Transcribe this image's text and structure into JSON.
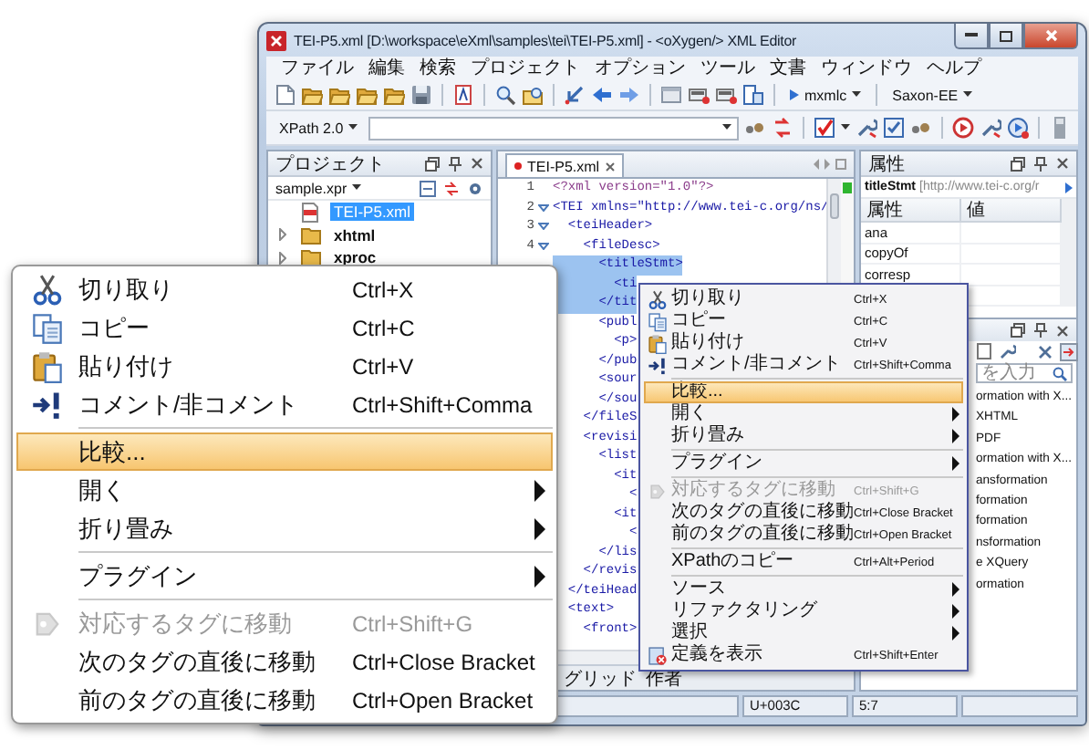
{
  "window": {
    "title": "TEI-P5.xml [D:\\workspace\\eXml\\samples\\tei\\TEI-P5.xml] - <oXygen/> XML Editor"
  },
  "menu_bar": [
    "ファイル",
    "編集",
    "検索",
    "プロジェクト",
    "オプション",
    "ツール",
    "文書",
    "ウィンドウ",
    "ヘルプ"
  ],
  "toolbar": {
    "scenario": "mxmlc",
    "engine": "Saxon-EE"
  },
  "xpath_bar": {
    "version": "XPath 2.0"
  },
  "project_panel": {
    "title": "プロジェクト",
    "project": "sample.xpr",
    "tree": [
      {
        "label": "TEI-P5.xml",
        "kind": "file",
        "selected": true
      },
      {
        "label": "xhtml",
        "kind": "folder",
        "selected": false
      },
      {
        "label": "xproc",
        "kind": "folder",
        "selected": false
      }
    ]
  },
  "editor": {
    "tab": {
      "label": "TEI-P5.xml",
      "modified": true
    },
    "lines": [
      {
        "number": "1",
        "text": "<?xml version=\"1.0\"?>",
        "fold": false,
        "selected": false
      },
      {
        "number": "2",
        "text": "<TEI xmlns=\"http://www.tei-c.org/ns/",
        "fold": true,
        "selected": false
      },
      {
        "number": "3",
        "text": "  <teiHeader>",
        "fold": true,
        "selected": false
      },
      {
        "number": "4",
        "text": "    <fileDesc>",
        "fold": true,
        "selected": false
      },
      {
        "text": "      <titleStmt>",
        "selected": true
      },
      {
        "text": "        <ti",
        "selected": true
      },
      {
        "text": "      </tit",
        "selected": true
      },
      {
        "text": "      <publ",
        "selected": false
      },
      {
        "text": "        <p>",
        "selected": false
      },
      {
        "text": "      </pub",
        "selected": false
      },
      {
        "text": "      <sour",
        "selected": false
      },
      {
        "text": "      </sou",
        "selected": false
      },
      {
        "text": "    </fileS",
        "selected": false
      },
      {
        "text": "    <revisi",
        "selected": false
      },
      {
        "text": "      <list",
        "selected": false
      },
      {
        "text": "        <it",
        "selected": false
      },
      {
        "text": "          <",
        "selected": false
      },
      {
        "text": "        <it",
        "selected": false
      },
      {
        "text": "          <",
        "selected": false
      },
      {
        "text": "      </lis",
        "selected": false
      },
      {
        "text": "    </revis",
        "selected": false
      },
      {
        "text": "  </teiHead",
        "selected": false
      },
      {
        "text": "  <text>",
        "selected": false
      },
      {
        "text": "    <front>",
        "selected": false
      }
    ],
    "bottom_tabs": [
      "グリッド",
      "作者"
    ]
  },
  "attributes_panel": {
    "title": "属性",
    "element": "titleStmt",
    "namespace": "[http://www.tei-c.org/r",
    "columns": [
      "属性",
      "値"
    ],
    "rows": [
      "ana",
      "copyOf",
      "corresp"
    ]
  },
  "transform_panel": {
    "search_placeholder": "を入力",
    "items": [
      "ormation with X...",
      "XHTML",
      "PDF",
      "ormation with X...",
      "ansformation",
      "formation",
      "formation",
      "nsformation",
      "e XQuery",
      "ormation"
    ]
  },
  "status_bar": [
    "U+003C",
    "5:7"
  ],
  "context_menu": {
    "items": [
      {
        "kind": "cut",
        "label": "切り取り",
        "shortcut": "Ctrl+X",
        "submenu": false,
        "selected": false,
        "disabled": false
      },
      {
        "kind": "copy",
        "label": "コピー",
        "shortcut": "Ctrl+C",
        "submenu": false,
        "selected": false,
        "disabled": false
      },
      {
        "kind": "paste",
        "label": "貼り付け",
        "shortcut": "Ctrl+V",
        "submenu": false,
        "selected": false,
        "disabled": false
      },
      {
        "kind": "comment",
        "label": "コメント/非コメント",
        "shortcut": "Ctrl+Shift+Comma",
        "submenu": false,
        "selected": false,
        "disabled": false
      },
      {
        "kind": "separator"
      },
      {
        "kind": "plain",
        "label": "比較...",
        "submenu": false,
        "selected": true,
        "disabled": false
      },
      {
        "kind": "plain",
        "label": "開く",
        "submenu": true,
        "selected": false,
        "disabled": false
      },
      {
        "kind": "plain",
        "label": "折り畳み",
        "submenu": true,
        "selected": false,
        "disabled": false
      },
      {
        "kind": "separator"
      },
      {
        "kind": "plain",
        "label": "プラグイン",
        "submenu": true,
        "selected": false,
        "disabled": false
      },
      {
        "kind": "separator"
      },
      {
        "kind": "goto",
        "label": "対応するタグに移動",
        "shortcut": "Ctrl+Shift+G",
        "submenu": false,
        "selected": false,
        "disabled": true
      },
      {
        "kind": "plain",
        "label": "次のタグの直後に移動",
        "shortcut": "Ctrl+Close Bracket",
        "submenu": false,
        "selected": false,
        "disabled": false
      },
      {
        "kind": "plain",
        "label": "前のタグの直後に移動",
        "shortcut": "Ctrl+Open Bracket",
        "submenu": false,
        "selected": false,
        "disabled": false
      },
      {
        "kind": "separator"
      },
      {
        "kind": "plain",
        "label": "XPathのコピー",
        "shortcut": "Ctrl+Alt+Period",
        "submenu": false,
        "selected": false,
        "disabled": false
      },
      {
        "kind": "separator"
      },
      {
        "kind": "plain",
        "label": "ソース",
        "submenu": true,
        "selected": false,
        "disabled": false
      },
      {
        "kind": "plain",
        "label": "リファクタリング",
        "submenu": true,
        "selected": false,
        "disabled": false
      },
      {
        "kind": "plain",
        "label": "選択",
        "submenu": true,
        "selected": false,
        "disabled": false
      },
      {
        "kind": "definition",
        "label": "定義を表示",
        "shortcut": "Ctrl+Shift+Enter",
        "submenu": false,
        "selected": false,
        "disabled": false
      }
    ]
  },
  "zoomed_menu": {
    "items": [
      {
        "kind": "cut",
        "label": "切り取り",
        "shortcut": "Ctrl+X",
        "submenu": false,
        "selected": false,
        "disabled": false
      },
      {
        "kind": "copy",
        "label": "コピー",
        "shortcut": "Ctrl+C",
        "submenu": false,
        "selected": false,
        "disabled": false
      },
      {
        "kind": "paste",
        "label": "貼り付け",
        "shortcut": "Ctrl+V",
        "submenu": false,
        "selected": false,
        "disabled": false
      },
      {
        "kind": "comment",
        "label": "コメント/非コメント",
        "shortcut": "Ctrl+Shift+Comma",
        "submenu": false,
        "selected": false,
        "disabled": false
      },
      {
        "kind": "separator"
      },
      {
        "kind": "plain",
        "label": "比較...",
        "submenu": false,
        "selected": true,
        "disabled": false
      },
      {
        "kind": "plain",
        "label": "開く",
        "submenu": true,
        "selected": false,
        "disabled": false
      },
      {
        "kind": "plain",
        "label": "折り畳み",
        "submenu": true,
        "selected": false,
        "disabled": false
      },
      {
        "kind": "separator"
      },
      {
        "kind": "plain",
        "label": "プラグイン",
        "submenu": true,
        "selected": false,
        "disabled": false
      },
      {
        "kind": "separator"
      },
      {
        "kind": "goto",
        "label": "対応するタグに移動",
        "shortcut": "Ctrl+Shift+G",
        "submenu": false,
        "selected": false,
        "disabled": true
      },
      {
        "kind": "plain",
        "label": "次のタグの直後に移動",
        "shortcut": "Ctrl+Close Bracket",
        "submenu": false,
        "selected": false,
        "disabled": false
      },
      {
        "kind": "plain",
        "label": "前のタグの直後に移動",
        "shortcut": "Ctrl+Open Bracket",
        "submenu": false,
        "selected": false,
        "disabled": false
      }
    ]
  }
}
